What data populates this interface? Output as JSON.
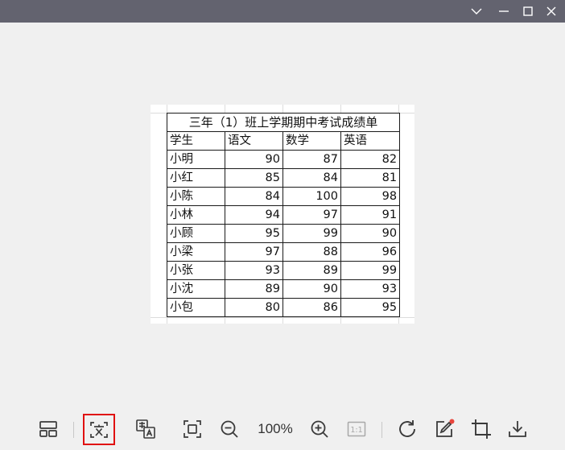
{
  "sheet": {
    "title": "三年（1）班上学期期中考试成绩单",
    "headers": [
      "学生",
      "语文",
      "数学",
      "英语"
    ],
    "rows": [
      [
        "小明",
        "90",
        "87",
        "82"
      ],
      [
        "小红",
        "85",
        "84",
        "81"
      ],
      [
        "小陈",
        "84",
        "100",
        "98"
      ],
      [
        "小林",
        "94",
        "97",
        "91"
      ],
      [
        "小顾",
        "95",
        "99",
        "90"
      ],
      [
        "小梁",
        "97",
        "88",
        "96"
      ],
      [
        "小张",
        "93",
        "89",
        "99"
      ],
      [
        "小沈",
        "89",
        "90",
        "93"
      ],
      [
        "小包",
        "80",
        "86",
        "95"
      ]
    ]
  },
  "toolbar": {
    "zoom": "100%",
    "actual_size": "1:1"
  },
  "colors": {
    "titlebar": "#63636f",
    "background": "#f0f0f0",
    "icon": "#3a3a3a",
    "active_border": "#e01010",
    "badge": "#e8453c"
  },
  "icons": {
    "titlebar": [
      "chevron-down-icon",
      "minimize-icon",
      "maximize-icon",
      "close-icon"
    ],
    "toolbar": [
      "layout-icon",
      "text-recognition-icon",
      "translate-icon",
      "fit-screen-icon",
      "zoom-out-icon",
      "zoom-in-icon",
      "actual-size-icon",
      "rotate-icon",
      "edit-icon",
      "crop-icon",
      "download-icon"
    ]
  }
}
